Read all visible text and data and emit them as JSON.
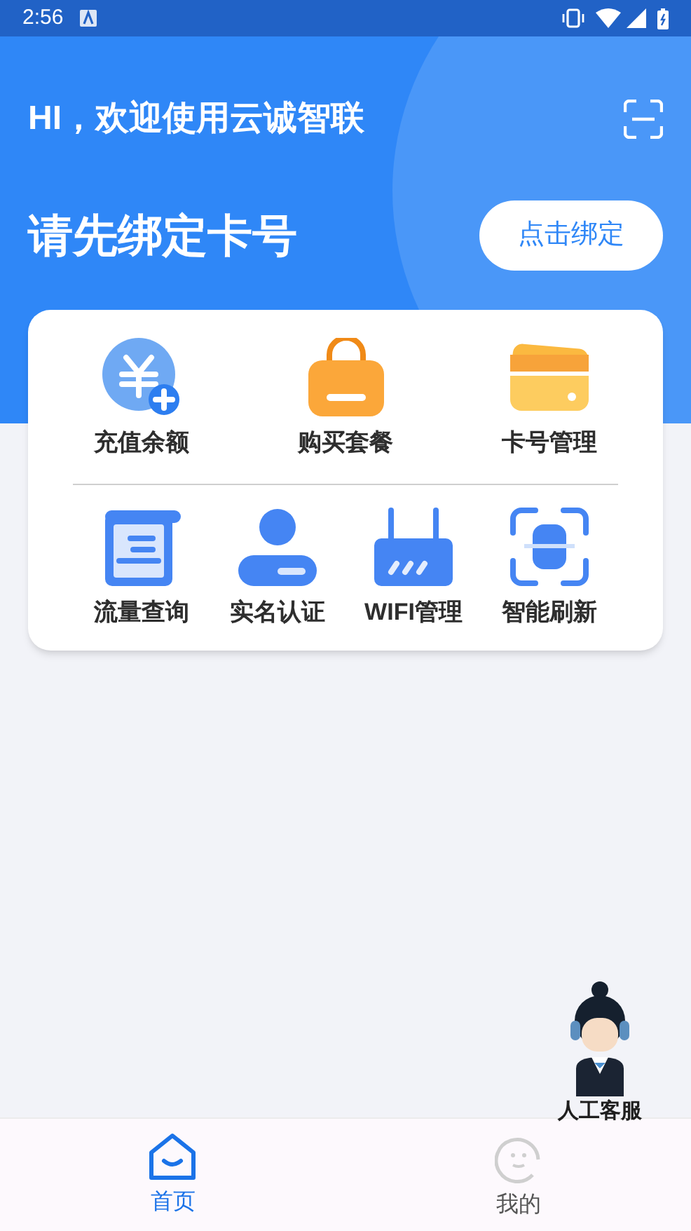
{
  "status_bar": {
    "time": "2:56"
  },
  "header": {
    "greeting": "HI，欢迎使用云诚智联",
    "prompt": "请先绑定卡号",
    "bind_button": "点击绑定"
  },
  "menu": {
    "top_row": [
      {
        "label": "充值余额"
      },
      {
        "label": "购买套餐"
      },
      {
        "label": "卡号管理"
      }
    ],
    "bottom_row": [
      {
        "label": "流量查询"
      },
      {
        "label": "实名认证"
      },
      {
        "label": "WIFI管理"
      },
      {
        "label": "智能刷新"
      }
    ]
  },
  "support": {
    "label": "人工客服"
  },
  "bottom_nav": [
    {
      "label": "首页",
      "selected": true
    },
    {
      "label": "我的",
      "selected": false
    }
  ]
}
